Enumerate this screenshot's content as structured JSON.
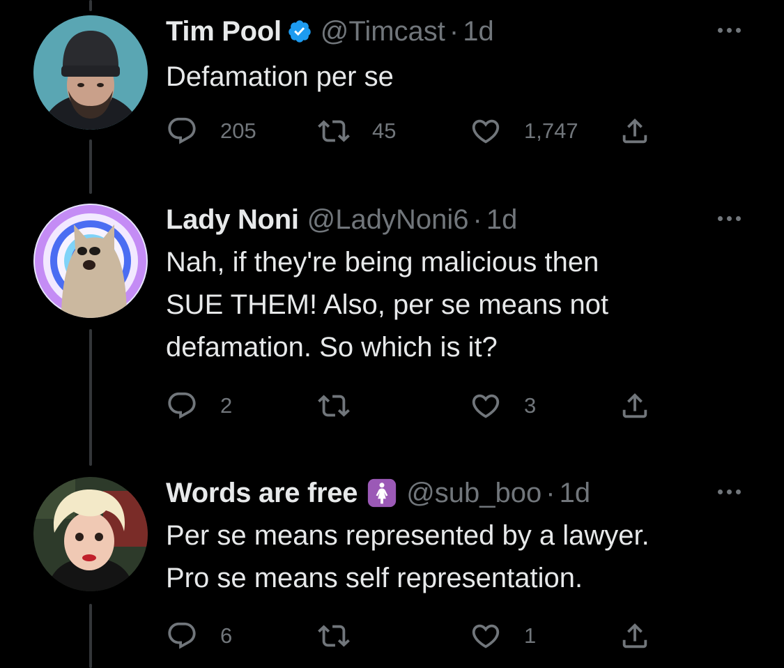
{
  "tweets": [
    {
      "author_name": "Tim Pool",
      "verified": true,
      "handle": "@Timcast",
      "separator": "·",
      "time": "1d",
      "text_lines": [
        "Defamation per se"
      ],
      "reply_count": "205",
      "retweet_count": "45",
      "like_count": "1,747",
      "avatar": "man-in-beanie-avatar"
    },
    {
      "author_name": "Lady Noni",
      "verified": false,
      "handle": "@LadyNoni6",
      "separator": "·",
      "time": "1d",
      "text_lines": [
        "Nah, if they're being malicious then",
        "SUE THEM! Also, per se means not",
        "defamation. So which is it?"
      ],
      "reply_count": "2",
      "retweet_count": "",
      "like_count": "3",
      "avatar": "pop-cat-spiral-avatar"
    },
    {
      "author_name": "Words are free",
      "name_emoji": "woman-symbol-emoji",
      "handle": "@sub_boo",
      "separator": "·",
      "time": "1d",
      "text_lines": [
        "Per se means represented by a lawyer.",
        "Pro se means self representation."
      ],
      "reply_count": "6",
      "retweet_count": "",
      "like_count": "1",
      "avatar": "blonde-woman-avatar"
    }
  ],
  "colors": {
    "background": "#000000",
    "primary_text": "#e7e9ea",
    "secondary_text": "#71767b",
    "verified_blue": "#1d9bf0",
    "emoji_purple": "#9b59b6",
    "thread_line": "#333639"
  },
  "icons": {
    "reply": "reply-icon",
    "retweet": "retweet-icon",
    "like": "heart-icon",
    "share": "share-icon",
    "more": "more-icon"
  }
}
